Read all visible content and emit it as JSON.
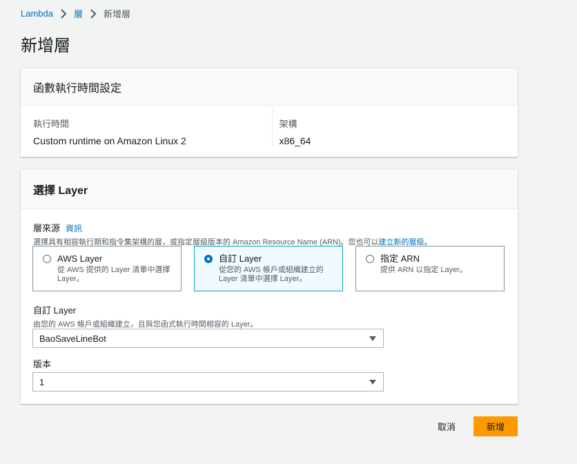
{
  "breadcrumb": {
    "items": [
      "Lambda",
      "層"
    ],
    "current": "新增層"
  },
  "page_title": "新增層",
  "runtime_panel": {
    "title": "函數執行時間設定",
    "runtime_label": "執行時間",
    "runtime_value": "Custom runtime on Amazon Linux 2",
    "arch_label": "架構",
    "arch_value": "x86_64"
  },
  "layer_panel": {
    "title": "選擇 Layer",
    "source_label": "層來源",
    "info_link": "資訊",
    "source_desc_prefix": "選擇具有相容執行期和指令集架構的層，或指定層級版本的 Amazon Resource Name (ARN)。您也可以",
    "source_desc_link": "建立新的層級",
    "source_desc_suffix": "。",
    "options": [
      {
        "title": "AWS Layer",
        "desc": "從 AWS 提供的 Layer 清單中選擇 Layer。",
        "selected": false
      },
      {
        "title": "自訂 Layer",
        "desc": "從您的 AWS 帳戶或組織建立的 Layer 清單中選擇 Layer。",
        "selected": true
      },
      {
        "title": "指定 ARN",
        "desc": "提供 ARN 以指定 Layer。",
        "selected": false
      }
    ],
    "custom_layer_label": "自訂 Layer",
    "custom_layer_desc": "由您的 AWS 帳戶或組織建立，且與您函式執行時間相容的 Layer。",
    "custom_layer_value": "BaoSaveLineBot",
    "version_label": "版本",
    "version_value": "1"
  },
  "footer": {
    "cancel_label": "取消",
    "submit_label": "新增"
  },
  "colors": {
    "accent": "#0073bb",
    "primary_button": "#ff9900",
    "selected_border": "#00a1c9"
  }
}
